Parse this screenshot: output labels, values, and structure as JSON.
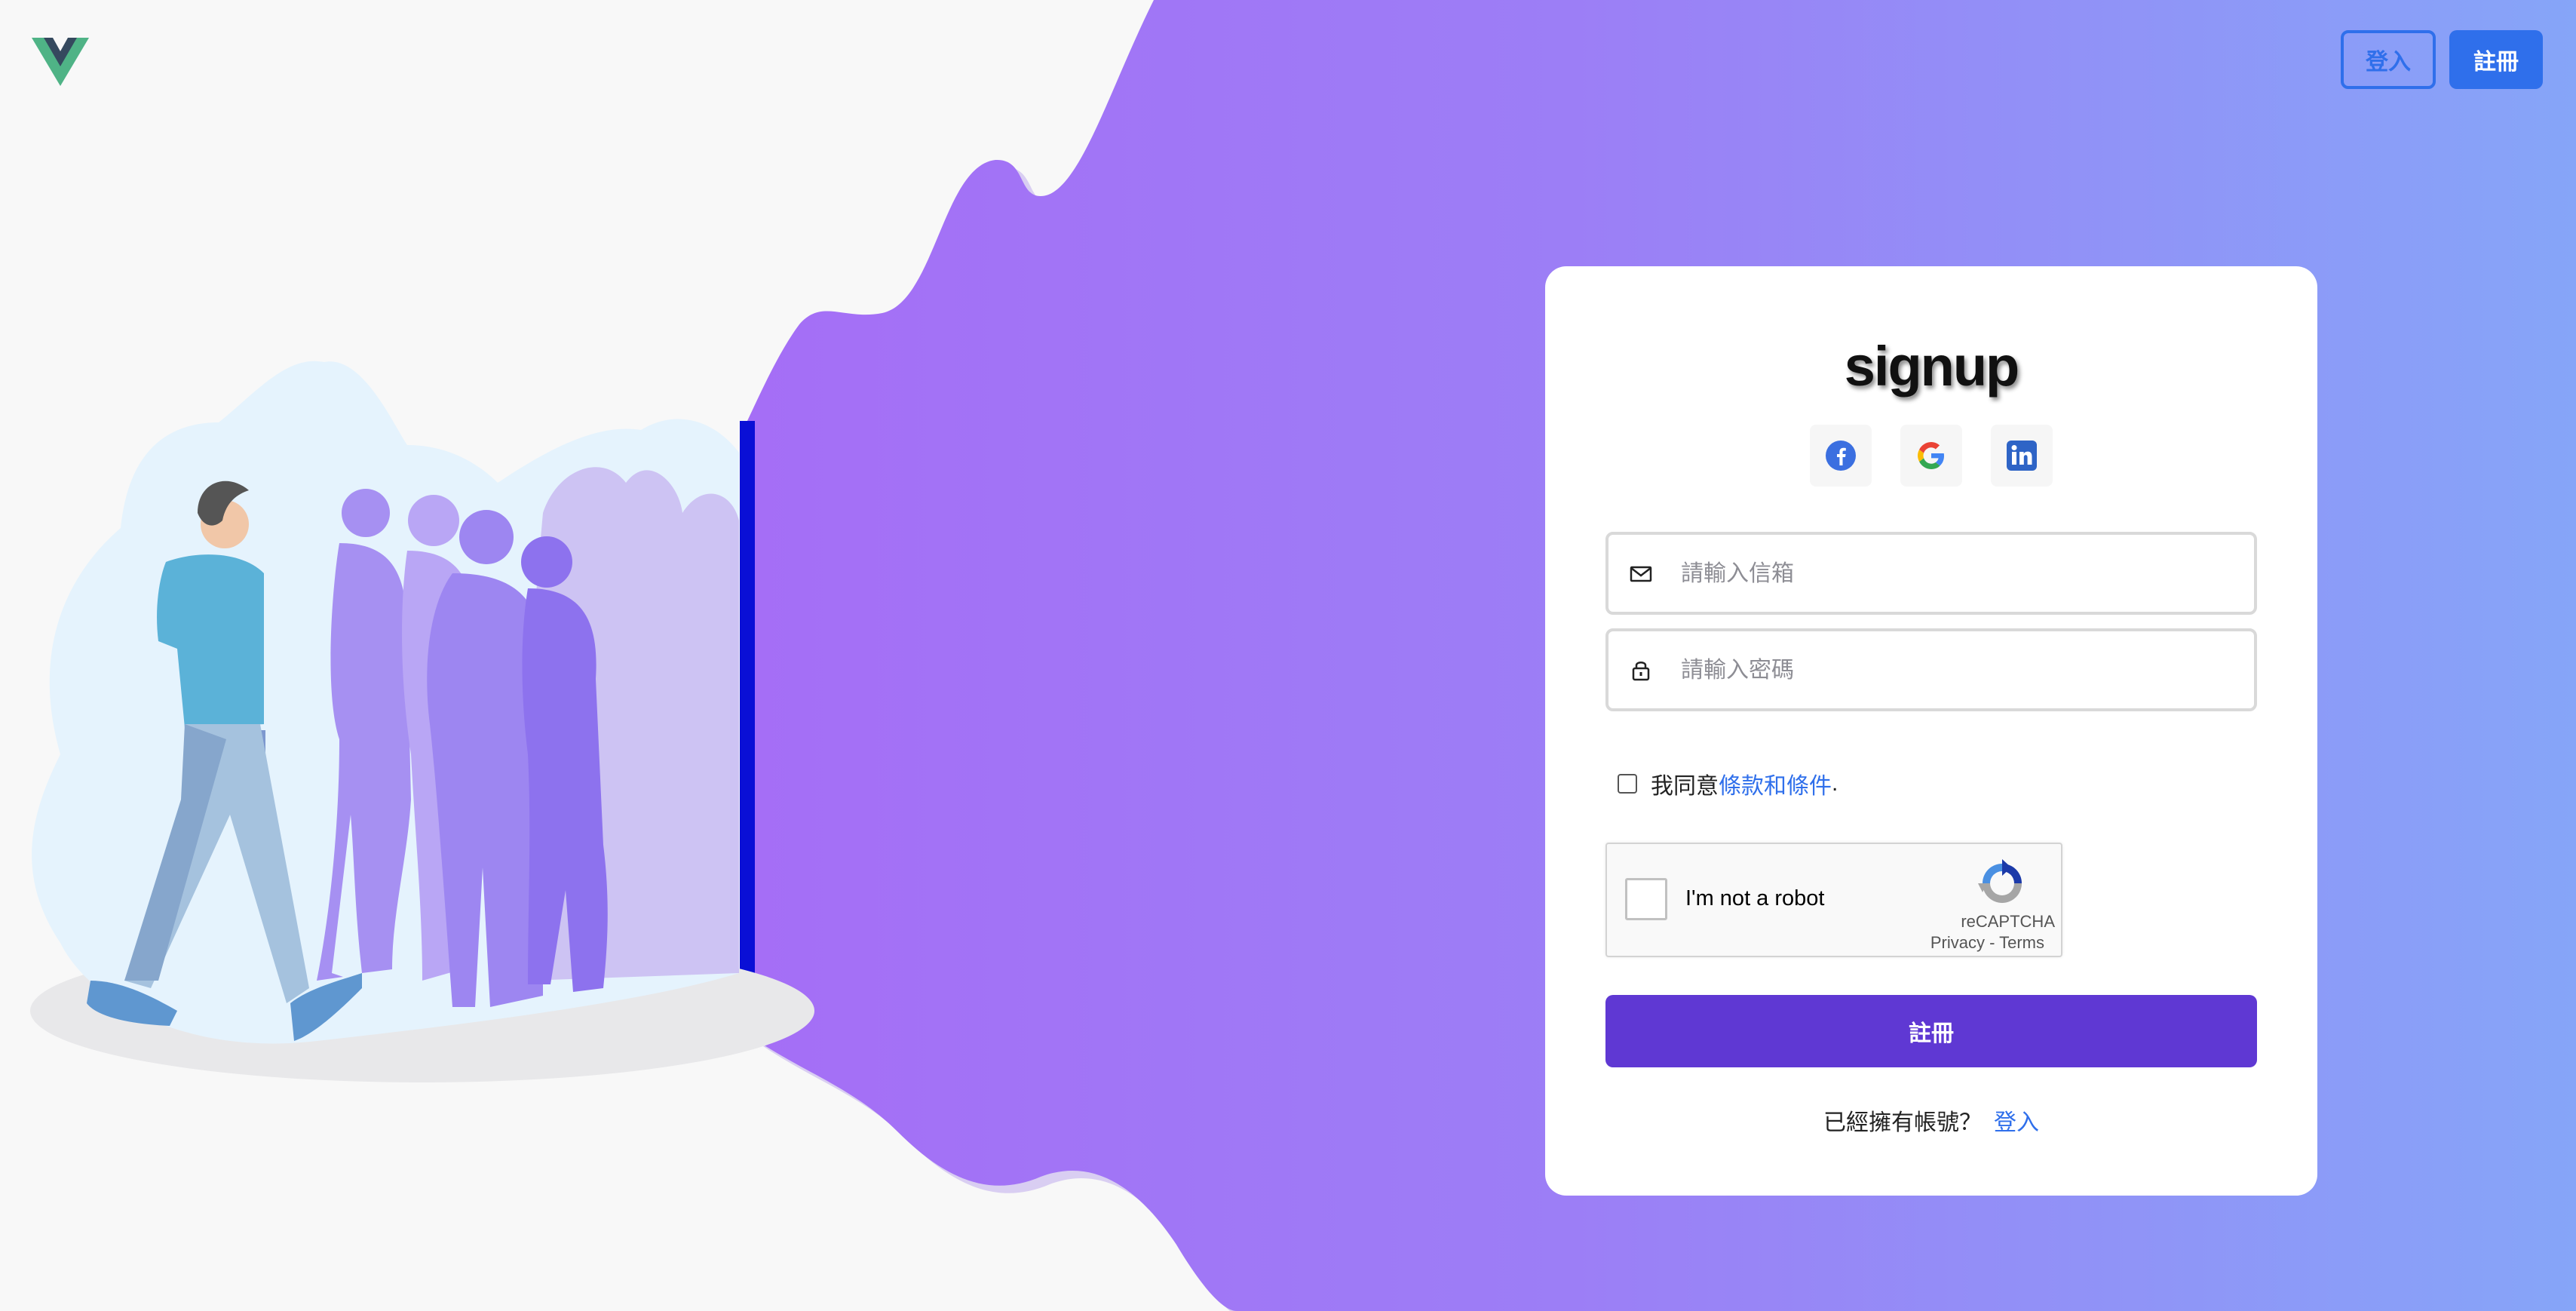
{
  "header": {
    "logo_icon": "vue-logo-icon",
    "login_label": "登入",
    "register_label": "註冊"
  },
  "illustration": {
    "icon": "people-walking-illustration"
  },
  "card": {
    "title": "signup",
    "social": [
      {
        "name": "facebook",
        "icon": "facebook-icon"
      },
      {
        "name": "google",
        "icon": "google-icon"
      },
      {
        "name": "linkedin",
        "icon": "linkedin-icon"
      }
    ],
    "email": {
      "value": "",
      "placeholder": "請輸入信箱",
      "icon": "mail-icon"
    },
    "password": {
      "value": "",
      "placeholder": "請輸入密碼",
      "icon": "lock-icon"
    },
    "agree": {
      "prefix": "我同意",
      "link": "條款和條件",
      "suffix": ".",
      "checked": false
    },
    "recaptcha": {
      "label": "I'm not a robot",
      "brand": "reCAPTCHA",
      "privacy": "Privacy",
      "separator": " - ",
      "terms": "Terms"
    },
    "submit_label": "註冊",
    "footer": {
      "text": "已經擁有帳號？",
      "link": "登入"
    }
  },
  "colors": {
    "accent": "#2f6feb",
    "submit": "#5f38d3",
    "gradient_start": "#a66ff7",
    "gradient_end": "#86a4f8"
  }
}
